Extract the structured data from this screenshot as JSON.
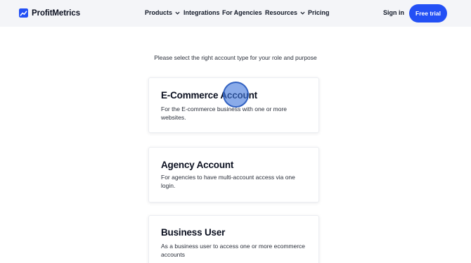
{
  "brand": {
    "name": "ProfitMetrics",
    "accent": "#2350f5"
  },
  "nav": {
    "products": "Products",
    "integrations": "Integrations",
    "agencies": "For Agencies",
    "resources": "Resources",
    "pricing": "Pricing"
  },
  "header": {
    "signin": "Sign in",
    "cta": "Free trial"
  },
  "main": {
    "prompt": "Please select the right account type for your role and purpose",
    "cards": [
      {
        "title": "E-Commerce Account",
        "description": "For the E-commerce business with one or more websites."
      },
      {
        "title": "Agency Account",
        "description": "For agencies to have multi-account access via one login."
      },
      {
        "title": "Business User",
        "description": "As a business user to access one or more ecommerce accounts"
      }
    ]
  },
  "icons": {
    "logo": "trending-chart-icon",
    "dropdown": "chevron-down-icon",
    "pointer": "cursor-indicator"
  }
}
